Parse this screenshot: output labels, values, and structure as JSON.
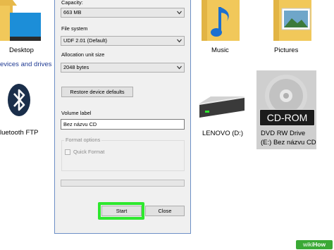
{
  "explorer": {
    "items": {
      "desktop": "Desktop",
      "music": "Music",
      "pictures": "Pictures"
    },
    "section_header": "evices and drives",
    "devices": {
      "bluetooth": "luetooth FTP",
      "lenovo": "LENOVO (D:)",
      "dvd_line1": "DVD RW Drive",
      "dvd_line2": "(E:) Bez názvu CD",
      "cdrom_badge": "CD-ROM"
    }
  },
  "dialog": {
    "capacity": {
      "label": "Capacity:",
      "value": "663 MB"
    },
    "file_system": {
      "label": "File system",
      "value": "UDF 2.01 (Default)"
    },
    "allocation": {
      "label": "Allocation unit size",
      "value": "2048 bytes"
    },
    "restore_button": "Restore device defaults",
    "volume_label": {
      "label": "Volume label",
      "value": "Bez názvu CD"
    },
    "format_options": {
      "title": "Format options",
      "quick_format": "Quick Format",
      "quick_format_checked": false,
      "enabled": false
    },
    "progress": 0,
    "start_button": "Start",
    "close_button": "Close"
  },
  "watermark": {
    "prefix": "wiki",
    "suffix": "How"
  },
  "colors": {
    "folder_yellow": "#f1c85a",
    "music_blue": "#1b6fd0",
    "highlight_green": "#2ee82e",
    "section_blue": "#1f3a93"
  },
  "icons": [
    "folder-icon",
    "music-note-icon",
    "bluetooth-icon",
    "hard-drive-icon",
    "optical-disc-icon",
    "chevron-down-icon"
  ]
}
